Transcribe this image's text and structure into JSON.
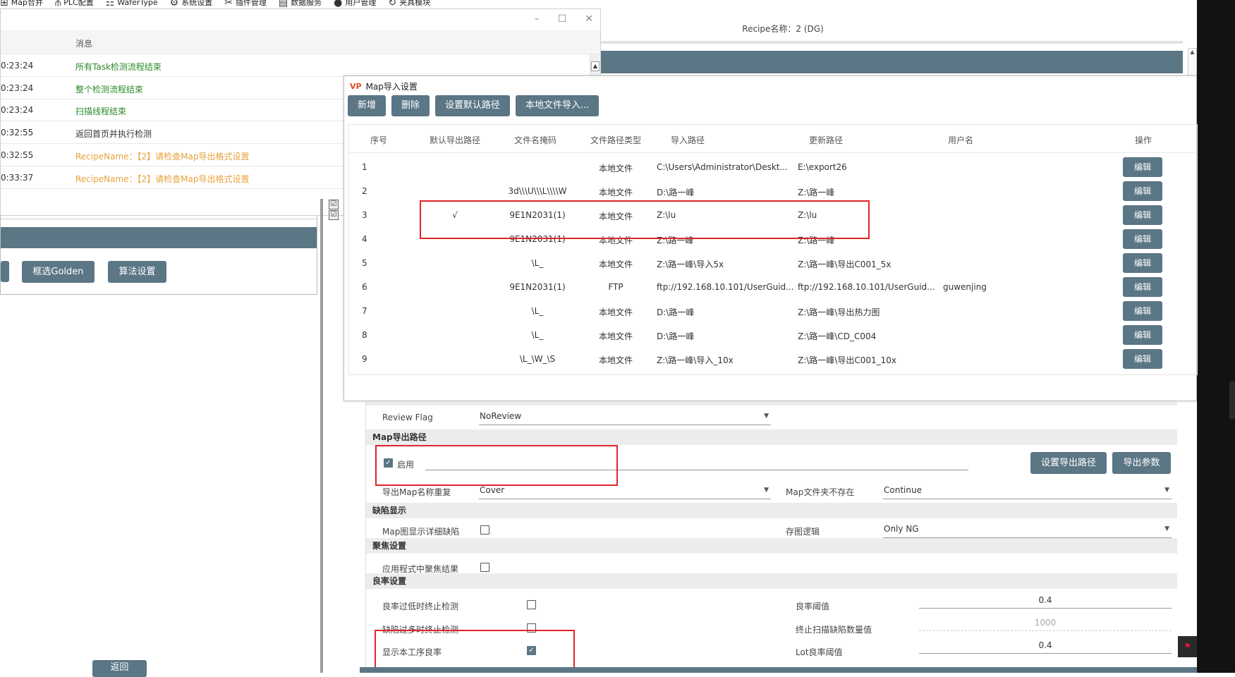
{
  "menubar": [
    {
      "label": "Map合并",
      "icon": "map-icon"
    },
    {
      "label": "PLC配置",
      "icon": "plc-icon"
    },
    {
      "label": "WaferType",
      "icon": "wafer-type-icon"
    },
    {
      "label": "系统设置",
      "icon": "gear-icon"
    },
    {
      "label": "插件管理",
      "icon": "plugin-icon"
    },
    {
      "label": "数据服务",
      "icon": "data-service-icon"
    },
    {
      "label": "用户管理",
      "icon": "user-icon"
    },
    {
      "label": "夹具模块",
      "icon": "fixture-icon"
    }
  ],
  "recipe_title": "Recipe名称：2 (DG)",
  "message_window": {
    "header": "消息",
    "rows": [
      {
        "time": "0:23:24",
        "text": "所有Task检测流程结束",
        "color": "green"
      },
      {
        "time": "0:23:24",
        "text": "整个检测流程结束",
        "color": "green"
      },
      {
        "time": "0:23:24",
        "text": "扫描线程结束",
        "color": "green"
      },
      {
        "time": "0:32:55",
        "text": "返回首页并执行检测",
        "color": "black"
      },
      {
        "time": "0:32:55",
        "text": "RecipeName：【2】请检查Map导出格式设置",
        "color": "orange"
      },
      {
        "time": "0:33:37",
        "text": "RecipeName：【2】请检查Map导出格式设置",
        "color": "orange"
      }
    ]
  },
  "left_panel": {
    "btn_golden": "框选Golden",
    "btn_algo": "算法设置",
    "btn_return": "返回"
  },
  "dialog": {
    "title": "Map导入设置",
    "buttons": {
      "add": "新增",
      "delete": "删除",
      "set_default": "设置默认路径",
      "local_import": "本地文件导入..."
    },
    "columns": {
      "seq": "序号",
      "default_export": "默认导出路径",
      "mask": "文件名掩码",
      "path_type": "文件路径类型",
      "import_path": "导入路径",
      "update_path": "更新路径",
      "user": "用户名",
      "op": "操作"
    },
    "edit_label": "编辑",
    "rows": [
      {
        "seq": "1",
        "default": "",
        "mask": "",
        "type": "本地文件",
        "import": "C:\\Users\\Administrator\\Deskt...",
        "update": "E:\\export26",
        "user": ""
      },
      {
        "seq": "2",
        "default": "",
        "mask": "3d\\\\\\U\\\\\\L\\\\\\\\W",
        "type": "本地文件",
        "import": "D:\\路一峰",
        "update": "Z:\\路一峰",
        "user": ""
      },
      {
        "seq": "3",
        "default": "√",
        "mask": "9E1N2031(1)",
        "type": "本地文件",
        "import": "Z:\\lu",
        "update": "Z:\\lu",
        "user": ""
      },
      {
        "seq": "4",
        "default": "",
        "mask": "9E1N2031(1)",
        "type": "本地文件",
        "import": "Z:\\路一峰",
        "update": "Z:\\路一峰",
        "user": ""
      },
      {
        "seq": "5",
        "default": "",
        "mask": "\\L_",
        "type": "本地文件",
        "import": "Z:\\路一峰\\导入5x",
        "update": "Z:\\路一峰\\导出C001_5x",
        "user": ""
      },
      {
        "seq": "6",
        "default": "",
        "mask": "9E1N2031(1)",
        "type": "FTP",
        "import": "ftp://192.168.10.101/UserGuid...",
        "update": "ftp://192.168.10.101/UserGuid...",
        "user": "guwenjing"
      },
      {
        "seq": "7",
        "default": "",
        "mask": "\\L_",
        "type": "本地文件",
        "import": "D:\\路一峰",
        "update": "Z:\\路一峰\\导出热力图",
        "user": ""
      },
      {
        "seq": "8",
        "default": "",
        "mask": "\\L_",
        "type": "本地文件",
        "import": "D:\\路一峰",
        "update": "Z:\\路一峰\\CD_C004",
        "user": ""
      },
      {
        "seq": "9",
        "default": "",
        "mask": "\\L_\\W_\\S",
        "type": "本地文件",
        "import": "Z:\\路一峰\\导入_10x",
        "update": "Z:\\路一峰\\导出C001_10x",
        "user": ""
      }
    ]
  },
  "settings": {
    "review_flag_label": "Review Flag",
    "review_flag_value": "NoReview",
    "sec_export": "Map导出路径",
    "enable_label": "启用",
    "enable_checked": true,
    "btn_set_export": "设置导出路径",
    "btn_export_params": "导出参数",
    "dup_name_label": "导出Map名称重复",
    "dup_name_value": "Cover",
    "folder_missing_label": "Map文件夹不存在",
    "folder_missing_value": "Continue",
    "sec_defect": "缺陷显示",
    "show_detail_label": "Map图显示详细缺陷",
    "save_logic_label": "存图逻辑",
    "save_logic_value": "Only NG",
    "sec_focus": "聚焦设置",
    "apply_focus_label": "应用程式中聚焦结果",
    "sec_yield": "良率设置",
    "stop_low_yield_label": "良率过低时终止检测",
    "yield_threshold_label": "良率阈值",
    "yield_threshold_value": "0.4",
    "stop_many_defects_label": "缺陷过多时终止检测",
    "stop_defect_count_label": "终止扫描缺陷数量值",
    "stop_defect_count_value": "1000",
    "show_yield_label": "显示本工序良率",
    "show_yield_checked": true,
    "lot_yield_label": "Lot良率阈值",
    "lot_yield_value": "0.4"
  },
  "colors": {
    "accent": "#5b7685",
    "highlight": "#e0242b",
    "ok_green": "#2b8a2b",
    "warn_orange": "#e7a23a"
  }
}
